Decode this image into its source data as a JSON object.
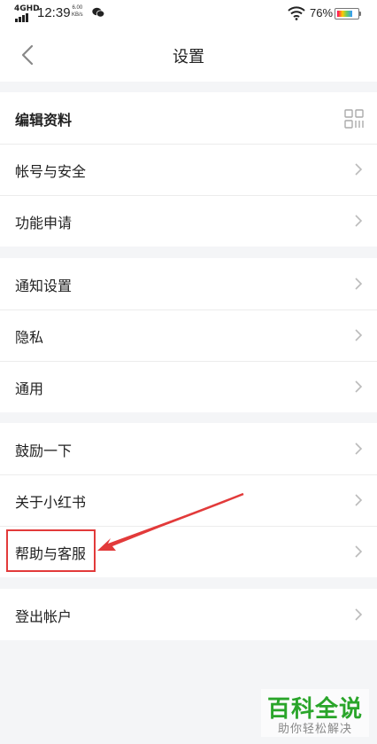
{
  "status_bar": {
    "network": "4GHD",
    "time": "12:39",
    "speed_value": "6.00",
    "speed_unit": "KB/s",
    "battery_percent": "76%",
    "battery_level": 0.76
  },
  "header": {
    "title": "设置"
  },
  "groups": [
    {
      "items": [
        {
          "label": "编辑资料",
          "trailing": "qr-code-icon"
        },
        {
          "label": "帐号与安全",
          "trailing": "chevron-right-icon"
        },
        {
          "label": "功能申请",
          "trailing": "chevron-right-icon"
        }
      ]
    },
    {
      "items": [
        {
          "label": "通知设置",
          "trailing": "chevron-right-icon"
        },
        {
          "label": "隐私",
          "trailing": "chevron-right-icon"
        },
        {
          "label": "通用",
          "trailing": "chevron-right-icon"
        }
      ]
    },
    {
      "items": [
        {
          "label": "鼓励一下",
          "trailing": "chevron-right-icon"
        },
        {
          "label": "关于小红书",
          "trailing": "chevron-right-icon"
        },
        {
          "label": "帮助与客服",
          "trailing": "chevron-right-icon"
        }
      ]
    },
    {
      "items": [
        {
          "label": "登出帐户",
          "trailing": "chevron-right-icon"
        }
      ]
    }
  ],
  "annotation": {
    "color": "#e23a3a"
  },
  "watermark": {
    "line1": "百科全说",
    "line2": "助你轻松解决"
  }
}
